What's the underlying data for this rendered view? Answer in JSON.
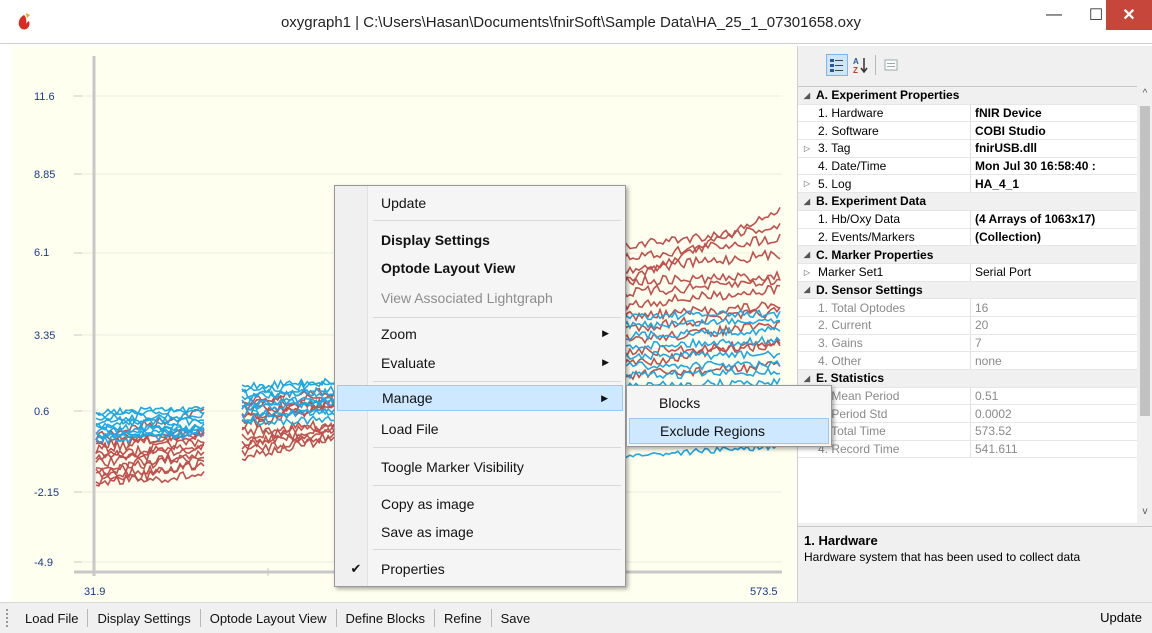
{
  "window": {
    "title": "oxygraph1 | C:\\Users\\Hasan\\Documents\\fnirSoft\\Sample Data\\HA_25_1_07301658.oxy",
    "minimize": "—",
    "maximize": "☐",
    "close": "✕"
  },
  "plot": {
    "yticks": [
      "11.6",
      "8.85",
      "6.1",
      "3.35",
      "0.6",
      "-2.15",
      "-4.9"
    ],
    "xticks": [
      "31.9",
      "573.5"
    ],
    "colors": {
      "background": "#fffff0",
      "oxy": "#c0504d",
      "deoxy": "#1ea7e1",
      "axis": "#c8c8c8"
    }
  },
  "context_menu": {
    "items": [
      {
        "label": "Update"
      },
      {
        "label": "Display Settings"
      },
      {
        "label": "Optode Layout View"
      },
      {
        "label": "View Associated Lightgraph"
      },
      {
        "label": "Zoom"
      },
      {
        "label": "Evaluate"
      },
      {
        "label": "Manage"
      },
      {
        "label": "Load File"
      },
      {
        "label": "Toogle Marker Visibility"
      },
      {
        "label": "Copy as image"
      },
      {
        "label": "Save as image"
      },
      {
        "label": "Properties"
      }
    ],
    "properties_checked": true,
    "submenu": [
      {
        "label": "Blocks"
      },
      {
        "label": "Exclude Regions"
      }
    ]
  },
  "propgrid": {
    "toolbar": {
      "categorized_icon": "categorized-icon",
      "alphabetical_icon": "alphabetical-icon",
      "pages_icon": "property-pages-icon"
    },
    "rows": [
      {
        "name": "A. Experiment Properties",
        "value": ""
      },
      {
        "name": "1. Hardware",
        "value": "fNIR Device"
      },
      {
        "name": "2. Software",
        "value": "COBI Studio"
      },
      {
        "name": "3. Tag",
        "value": "fnirUSB.dll"
      },
      {
        "name": "4. Date/Time",
        "value": "Mon Jul 30 16:58:40 :"
      },
      {
        "name": "5. Log",
        "value": "HA_4_1"
      },
      {
        "name": "B. Experiment Data",
        "value": ""
      },
      {
        "name": "1. Hb/Oxy Data",
        "value": "(4 Arrays of 1063x17)"
      },
      {
        "name": "2. Events/Markers",
        "value": "(Collection)"
      },
      {
        "name": "C. Marker Properties",
        "value": ""
      },
      {
        "name": "Marker Set1",
        "value": "Serial Port"
      },
      {
        "name": "D. Sensor Settings",
        "value": ""
      },
      {
        "name": "1. Total Optodes",
        "value": "16"
      },
      {
        "name": "2. Current",
        "value": "20"
      },
      {
        "name": "3. Gains",
        "value": "7"
      },
      {
        "name": "4. Other",
        "value": "none"
      },
      {
        "name": "E. Statistics",
        "value": ""
      },
      {
        "name": "1. Mean Period",
        "value": "0.51"
      },
      {
        "name": "2. Period Std",
        "value": "0.0002"
      },
      {
        "name": "3. Total Time",
        "value": "573.52"
      },
      {
        "name": "4. Record Time",
        "value": "541.611"
      }
    ],
    "help": {
      "title": "1. Hardware",
      "description": "Hardware system that has been used to collect data"
    }
  },
  "bottom_toolbar": {
    "items": [
      "Load File",
      "Display Settings",
      "Optode Layout View",
      "Define Blocks",
      "Refine",
      "Save"
    ],
    "right": "Update"
  }
}
